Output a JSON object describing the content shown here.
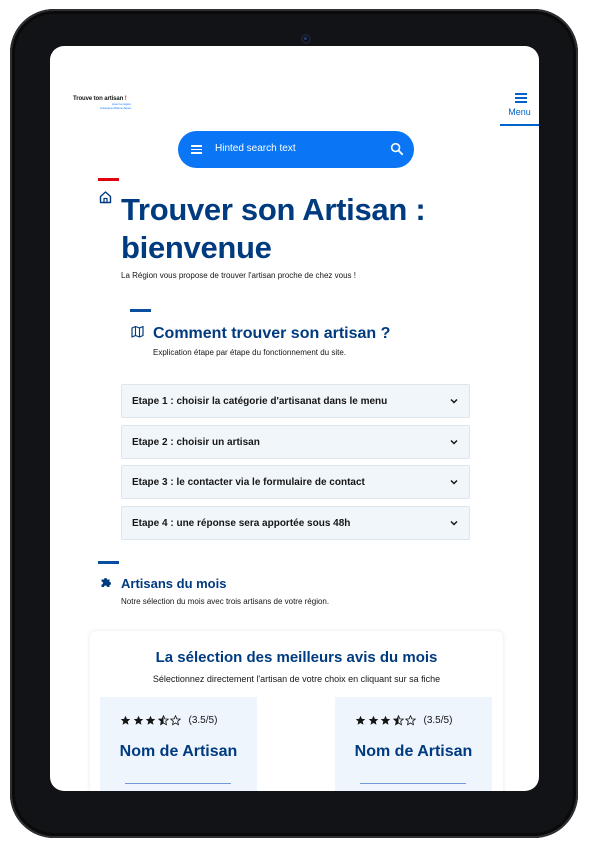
{
  "colors": {
    "primary": "#0063cb",
    "title": "#003b80",
    "accent_red": "#e1000f",
    "search_bg": "#0a76f6"
  },
  "header": {
    "logo_title": "Trouve ton artisan",
    "logo_mark": "!",
    "logo_line1": "Avec la région",
    "logo_line2": "Auvergne-Rhône-Alpes",
    "menu_icon": "hamburger-icon",
    "menu_label": "Menu"
  },
  "search": {
    "icon": "hamburger-icon",
    "placeholder": "Hinted search text",
    "button_icon": "search-icon"
  },
  "hero": {
    "icon": "home-icon",
    "title": "Trouver son Artisan : bienvenue",
    "subtitle": "La Région vous propose de trouver l'artisan proche de chez vous !"
  },
  "how_to": {
    "icon": "map-icon",
    "title": "Comment trouver son artisan ?",
    "subtitle": "Explication étape par étape du fonctionnement du site.",
    "steps": [
      {
        "label": "Etape 1 : choisir la catégorie d'artisanat dans le menu"
      },
      {
        "label": "Etape 2 : choisir un artisan"
      },
      {
        "label": "Etape 3 : le contacter via le formulaire de contact"
      },
      {
        "label": "Etape 4 : une réponse sera apportée sous 48h"
      }
    ]
  },
  "month": {
    "icon": "puzzle-icon",
    "title": "Artisans du mois",
    "subtitle": "Notre sélection du mois avec trois artisans de votre région."
  },
  "reviews": {
    "title": "La sélection des meilleurs avis du mois",
    "subtitle": "Sélectionnez directement l'artisan de votre choix en cliquant sur sa fiche",
    "cards": [
      {
        "stars": 3.5,
        "rating_text": "(3.5/5)",
        "name": "Nom de Artisan"
      },
      {
        "stars": 3.5,
        "rating_text": "(3.5/5)",
        "name": "Nom de Artisan"
      }
    ]
  }
}
